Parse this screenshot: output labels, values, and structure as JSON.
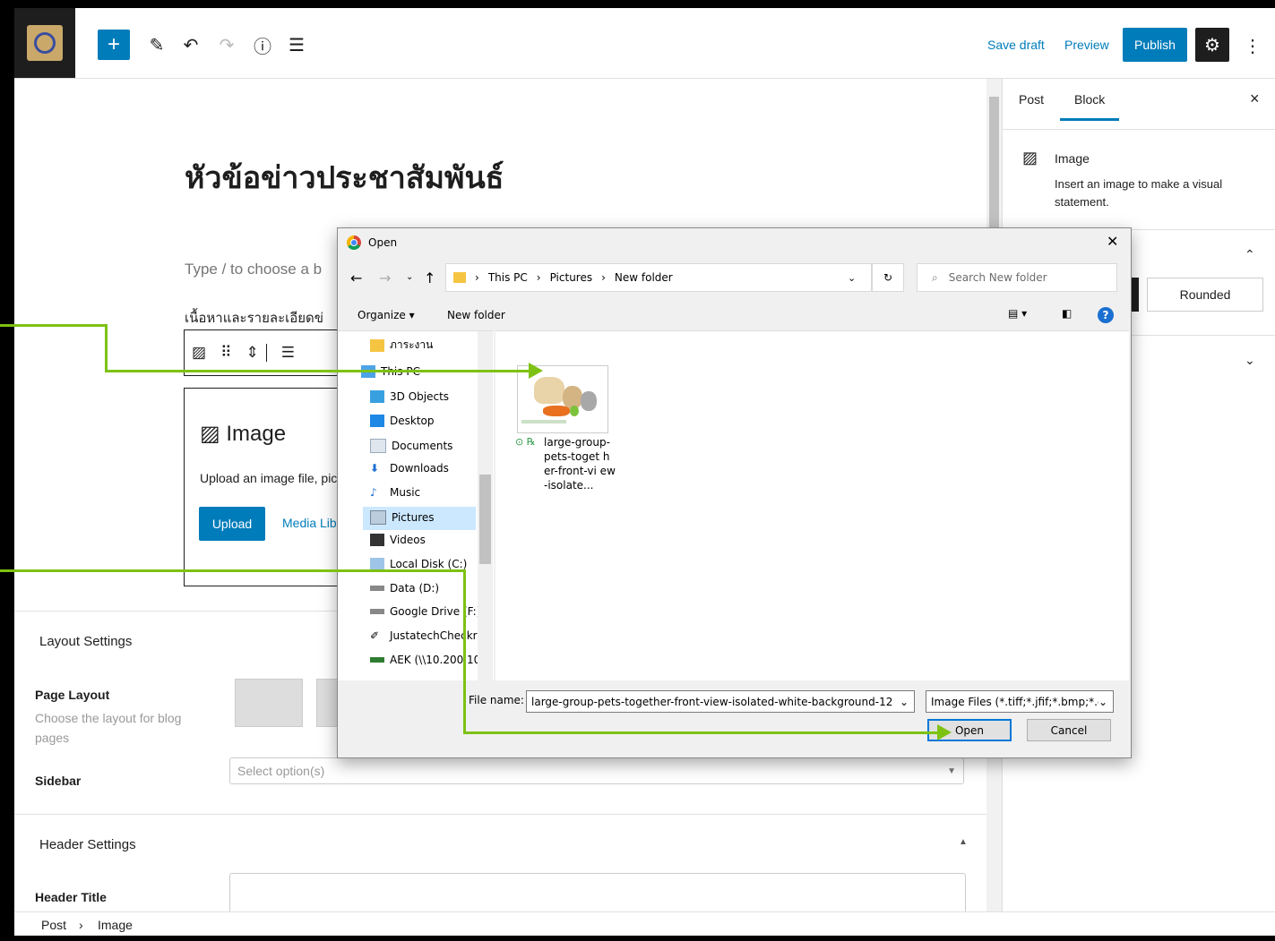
{
  "toolbar": {
    "save_draft": "Save draft",
    "preview": "Preview",
    "publish": "Publish"
  },
  "editor": {
    "post_title": "หัวข้อข่าวประชาสัมพันธ์",
    "block_placeholder": "Type / to choose a b",
    "paragraph": "เนื้อหาและรายละเอียดข่",
    "image_block": {
      "title": "Image",
      "description": "Upload an image file, pic",
      "upload": "Upload",
      "media_library": "Media Lib"
    }
  },
  "meta": {
    "layout_settings": "Layout Settings",
    "page_layout_label": "Page Layout",
    "page_layout_desc": "Choose the layout for blog pages",
    "sidebar_label": "Sidebar",
    "sidebar_placeholder": "Select option(s)",
    "header_settings": "Header Settings",
    "header_title_label": "Header Title"
  },
  "sidebar": {
    "tab_post": "Post",
    "tab_block": "Block",
    "block_name": "Image",
    "block_desc": "Insert an image to make a visual statement.",
    "rounded": "Rounded"
  },
  "footer": {
    "crumb_post": "Post",
    "crumb_sep": "›",
    "crumb_image": "Image"
  },
  "dialog": {
    "title": "Open",
    "path": [
      "This PC",
      "Pictures",
      "New folder"
    ],
    "search_placeholder": "Search New folder",
    "organize": "Organize ▾",
    "new_folder": "New folder",
    "nav_items": [
      "ภาระงาน",
      "This PC",
      "3D Objects",
      "Desktop",
      "Documents",
      "Downloads",
      "Music",
      "Pictures",
      "Videos",
      "Local Disk (C:)",
      "Data (D:)",
      "Google Drive (F:)",
      "JustatechCheckr",
      "AEK (\\\\10.200.10"
    ],
    "file_name_display": "large-group-pets-toget her-front-vi ew-isolate...",
    "file_name_label": "File name:",
    "file_name_value": "large-group-pets-together-front-view-isolated-white-background-12",
    "filter": "Image Files (*.tiff;*.jfif;*.bmp;*.g",
    "open": "Open",
    "cancel": "Cancel"
  },
  "colors": {
    "accent": "#007cba",
    "arrow": "#7dc213",
    "selected": "#cce8ff"
  }
}
